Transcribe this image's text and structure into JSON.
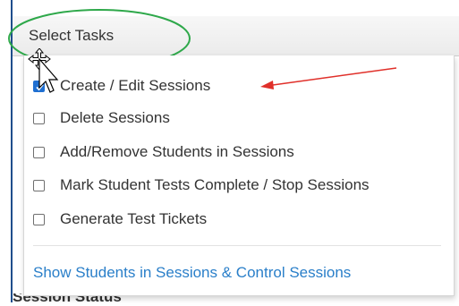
{
  "select": {
    "label": "Select Tasks"
  },
  "tasks": [
    {
      "label": "Create / Edit Sessions",
      "checked": true
    },
    {
      "label": "Delete Sessions",
      "checked": false
    },
    {
      "label": "Add/Remove Students in Sessions",
      "checked": false
    },
    {
      "label": "Mark Student Tests Complete / Stop Sessions",
      "checked": false
    },
    {
      "label": "Generate Test Tickets",
      "checked": false
    }
  ],
  "link": {
    "label": "Show Students in Sessions & Control Sessions"
  },
  "background": {
    "section_heading": "Session Status"
  },
  "colors": {
    "accent": "#1f6fd1",
    "link": "#2a7fc9",
    "annotation_ellipse": "#2ea84a",
    "annotation_arrow": "#e0302a"
  },
  "icons": [
    "move-cursor-icon",
    "pointer-cursor-icon",
    "red-arrow-icon",
    "checkmark-icon"
  ]
}
